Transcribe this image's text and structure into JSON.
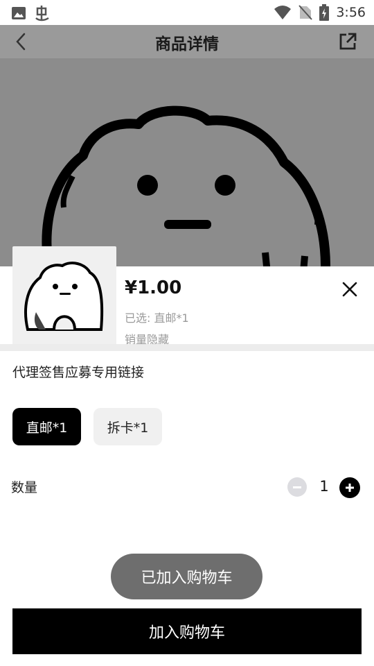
{
  "status_bar": {
    "time": "3:56"
  },
  "header": {
    "title": "商品详情"
  },
  "product": {
    "price": "¥1.00",
    "selected_text": "已选: 直邮*1",
    "sales_text": "销量隐藏",
    "spec_title": "代理签售应募专用链接"
  },
  "options": [
    {
      "label": "直邮*1",
      "selected": true
    },
    {
      "label": "拆卡*1",
      "selected": false
    }
  ],
  "quantity": {
    "label": "数量",
    "value": "1"
  },
  "toast": "已加入购物车",
  "cart_button": "加入购物车",
  "colors": {
    "primary": "#000000",
    "muted": "#9a9a9a",
    "option_bg": "#f0f0f0"
  }
}
